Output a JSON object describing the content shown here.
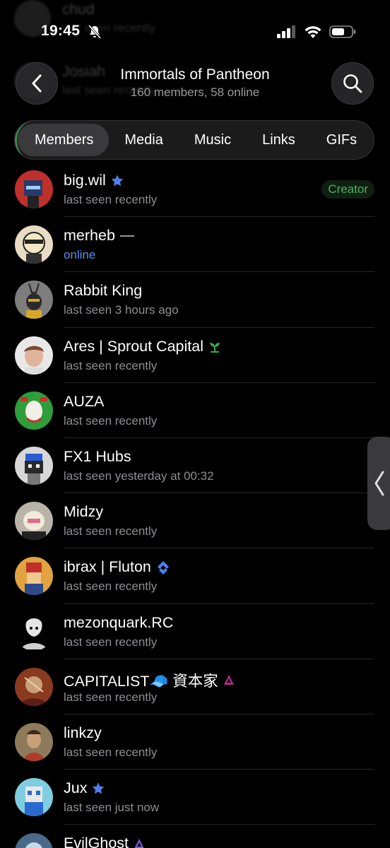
{
  "status_bar": {
    "time": "19:45"
  },
  "background_members": [
    {
      "name": "chud",
      "status": "last seen recently"
    },
    {
      "name": "Josiah",
      "status": "last seen recently"
    }
  ],
  "header": {
    "title": "Immortals of Pantheon",
    "subtitle": "160 members, 58 online"
  },
  "tabs": [
    {
      "label": "Members",
      "active": true
    },
    {
      "label": "Media",
      "active": false
    },
    {
      "label": "Music",
      "active": false
    },
    {
      "label": "Links",
      "active": false
    },
    {
      "label": "GIFs",
      "active": false
    }
  ],
  "members": [
    {
      "name": "big.wil",
      "status": "last seen recently",
      "badge": "star",
      "role": "Creator",
      "avatar_color": "#c0302a"
    },
    {
      "name": "merheb",
      "status": "online",
      "badge": "dash",
      "online": true,
      "avatar_color": "#e9dcc4"
    },
    {
      "name": "Rabbit King",
      "status": "last seen 3 hours ago",
      "avatar_color": "#7e7e7e"
    },
    {
      "name": "Ares | Sprout Capital",
      "status": "last seen recently",
      "badge": "sprout",
      "avatar_color": "#d8b9a3"
    },
    {
      "name": "AUZA",
      "status": "last seen recently",
      "avatar_color": "#2e9e3a"
    },
    {
      "name": "FX1 Hubs",
      "status": "last seen yesterday at 00:32",
      "avatar_color": "#d8d8d8"
    },
    {
      "name": "Midzy",
      "status": "last seen recently",
      "avatar_color": "#b9b4a8"
    },
    {
      "name": "ibrax | Fluton",
      "status": "last seen recently",
      "badge": "fluton",
      "avatar_color": "#e2a341"
    },
    {
      "name": "mezonquark.RC",
      "status": "last seen recently",
      "avatar_color": "#111111"
    },
    {
      "name": "CAPITALIST🧢 資本家",
      "status": "last seen recently",
      "badge": "triangle",
      "avatar_color": "#8a3a1f"
    },
    {
      "name": "linkzy",
      "status": "last seen recently",
      "avatar_color": "#8d7a5a"
    },
    {
      "name": "Jux",
      "status": "last seen just now",
      "badge": "star",
      "avatar_color": "#7fcde0"
    },
    {
      "name": "EvilGhost",
      "status": "",
      "badge": "triangle",
      "avatar_color": "#4a6a8a"
    }
  ],
  "colors": {
    "background": "#000000",
    "online": "#5b8cf0",
    "creator": "#4bb45c",
    "star": "#4f7ff0",
    "muted_text": "#8e8e93"
  }
}
